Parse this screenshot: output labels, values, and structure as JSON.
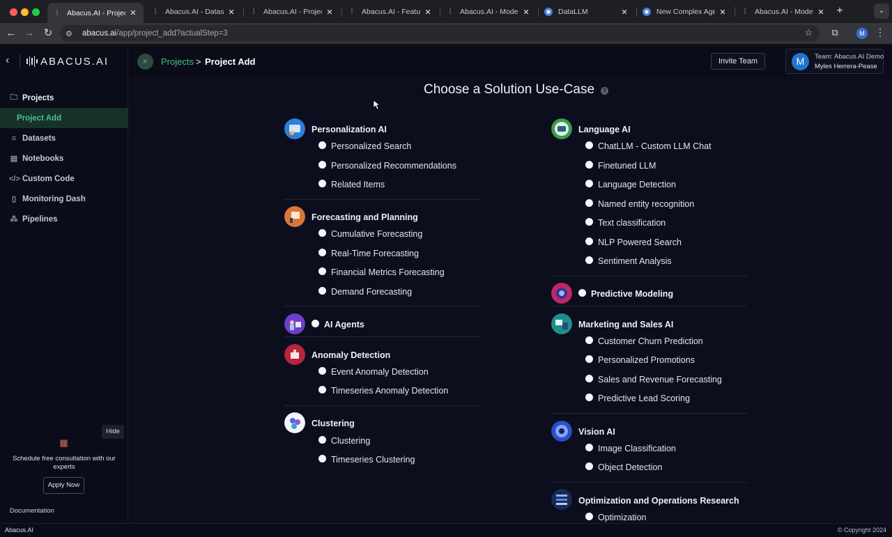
{
  "browser": {
    "tabs": [
      {
        "title": "Abacus.AI - Projects",
        "active": true
      },
      {
        "title": "Abacus.AI - Datasets"
      },
      {
        "title": "Abacus.AI - Project"
      },
      {
        "title": "Abacus.AI - Feature"
      },
      {
        "title": "Abacus.AI - Model -"
      },
      {
        "title": "DataLLM"
      },
      {
        "title": "New Complex Agent"
      },
      {
        "title": "Abacus.AI - Model -"
      }
    ],
    "url_host": "abacus.ai",
    "url_path": "/app/project_add?actualStep=3",
    "profile_initial": "M"
  },
  "app": {
    "logo_text": "ABACUS.AI",
    "breadcrumb": {
      "parent": "Projects",
      "separator": ">",
      "current": "Project Add"
    },
    "invite_label": "Invite Team",
    "team": {
      "avatar_initial": "M",
      "line1": "Team: Abacus.AI Demo",
      "line2": "Myles Herrera-Pease"
    }
  },
  "sidebar": {
    "items": [
      {
        "label": "Projects",
        "icon": "folder-icon"
      },
      {
        "label": "Project Add"
      },
      {
        "label": "Datasets",
        "icon": "database-icon"
      },
      {
        "label": "Notebooks",
        "icon": "notebook-icon"
      },
      {
        "label": "Custom Code",
        "icon": "code-icon"
      },
      {
        "label": "Monitoring Dash",
        "icon": "clipboard-icon"
      },
      {
        "label": "Pipelines",
        "icon": "pipeline-icon"
      }
    ],
    "hide_label": "Hide",
    "consult_text": "Schedule free consultation with our experts",
    "apply_label": "Apply Now",
    "documentation": "Documentation"
  },
  "main": {
    "title": "Choose a Solution Use-Case",
    "help": "?",
    "left_column": [
      {
        "title": "Personalization AI",
        "options": [
          "Personalized Search",
          "Personalized Recommendations",
          "Related Items"
        ]
      },
      {
        "title": "Forecasting and Planning",
        "options": [
          "Cumulative Forecasting",
          "Real-Time Forecasting",
          "Financial Metrics Forecasting",
          "Demand Forecasting"
        ]
      },
      {
        "title": "AI Agents",
        "options": []
      },
      {
        "title": "Anomaly Detection",
        "options": [
          "Event Anomaly Detection",
          "Timeseries Anomaly Detection"
        ]
      },
      {
        "title": "Clustering",
        "options": [
          "Clustering",
          "Timeseries Clustering"
        ]
      }
    ],
    "right_column": [
      {
        "title": "Language AI",
        "options": [
          "ChatLLM - Custom LLM Chat",
          "Finetuned LLM",
          "Language Detection",
          "Named entity recognition",
          "Text classification",
          "NLP Powered Search",
          "Sentiment Analysis"
        ]
      },
      {
        "title": "Predictive Modeling",
        "options": []
      },
      {
        "title": "Marketing and Sales AI",
        "options": [
          "Customer Churn Prediction",
          "Personalized Promotions",
          "Sales and Revenue Forecasting",
          "Predictive Lead Scoring"
        ]
      },
      {
        "title": "Vision AI",
        "options": [
          "Image Classification",
          "Object Detection"
        ]
      },
      {
        "title": "Optimization and Operations Research",
        "options": [
          "Optimization"
        ]
      }
    ]
  },
  "footer": {
    "left": "Abacus.AI",
    "right": "© Copyright 2024"
  },
  "colors": {
    "accent_green": "#46c28a",
    "background": "#0c0e1e",
    "sidebar_active_bg": "#17322a"
  }
}
